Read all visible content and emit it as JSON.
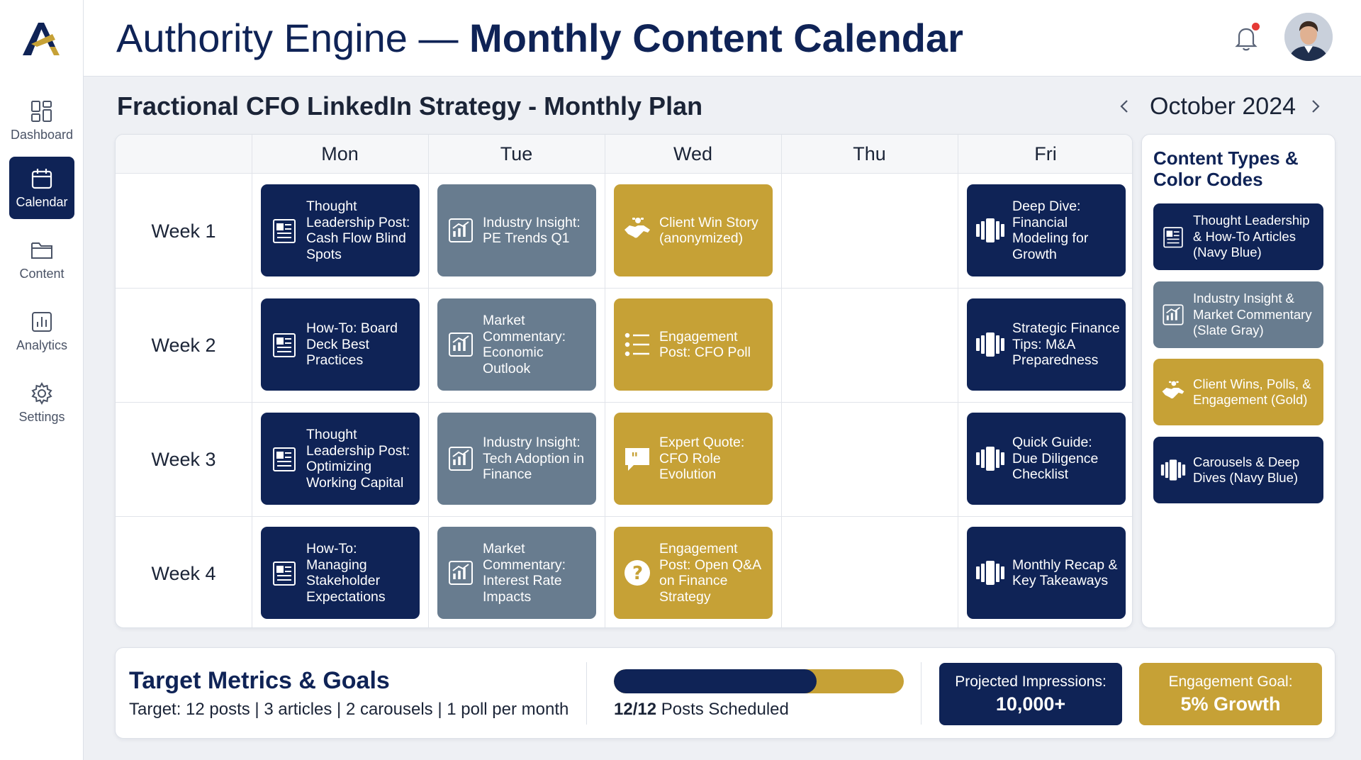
{
  "app": {
    "title_light": "Authority Engine — ",
    "title_bold": "Monthly Content Calendar"
  },
  "colors": {
    "navy": "#0f2356",
    "slate": "#687c8f",
    "gold": "#c6a136",
    "notification_dot": "#e53935"
  },
  "sidebar": {
    "items": [
      {
        "label": "Dashboard",
        "icon": "dashboard-icon",
        "active": false
      },
      {
        "label": "Calendar",
        "icon": "calendar-icon",
        "active": true
      },
      {
        "label": "Content",
        "icon": "folder-icon",
        "active": false
      },
      {
        "label": "Analytics",
        "icon": "bar-chart-icon",
        "active": false
      },
      {
        "label": "Settings",
        "icon": "gear-icon",
        "active": false
      }
    ]
  },
  "header": {
    "bell_icon": "bell-icon",
    "has_notification": true,
    "avatar": "user-avatar"
  },
  "plan": {
    "title": "Fractional CFO LinkedIn Strategy - Monthly Plan",
    "month": "October 2024"
  },
  "calendar": {
    "days": [
      "Mon",
      "Tue",
      "Wed",
      "Thu",
      "Fri"
    ],
    "weeks": [
      {
        "label": "Week 1",
        "cards": {
          "mon": {
            "text": "Thought Leadership Post: Cash Flow Blind Spots",
            "type": "navy",
            "icon": "article-icon"
          },
          "tue": {
            "text": "Industry Insight: PE Trends Q1",
            "type": "slate",
            "icon": "chart-icon"
          },
          "wed": {
            "text": "Client Win Story (anonymized)",
            "type": "gold",
            "icon": "handshake-icon"
          },
          "fri": {
            "text": "Deep Dive: Financial Modeling for Growth",
            "type": "navy",
            "icon": "carousel-icon"
          }
        }
      },
      {
        "label": "Week 2",
        "cards": {
          "mon": {
            "text": "How-To: Board Deck Best Practices",
            "type": "navy",
            "icon": "article-icon"
          },
          "tue": {
            "text": "Market Commentary: Economic Outlook",
            "type": "slate",
            "icon": "chart-icon"
          },
          "wed": {
            "text": "Engagement Post: CFO Poll",
            "type": "gold",
            "icon": "poll-list-icon"
          },
          "fri": {
            "text": "Strategic Finance Tips: M&A Preparedness",
            "type": "navy",
            "icon": "carousel-icon"
          }
        }
      },
      {
        "label": "Week 3",
        "cards": {
          "mon": {
            "text": "Thought Leadership Post: Optimizing Working Capital",
            "type": "navy",
            "icon": "article-icon"
          },
          "tue": {
            "text": "Industry Insight: Tech Adoption in Finance",
            "type": "slate",
            "icon": "chart-icon"
          },
          "wed": {
            "text": "Expert Quote: CFO Role Evolution",
            "type": "gold",
            "icon": "quote-icon"
          },
          "fri": {
            "text": "Quick Guide: Due Diligence Checklist",
            "type": "navy",
            "icon": "carousel-icon"
          }
        }
      },
      {
        "label": "Week 4",
        "cards": {
          "mon": {
            "text": "How-To: Managing Stakeholder Expectations",
            "type": "navy",
            "icon": "article-icon"
          },
          "tue": {
            "text": "Market Commentary: Interest Rate Impacts",
            "type": "slate",
            "icon": "chart-icon"
          },
          "wed": {
            "text": "Engagement Post: Open Q&A on Finance Strategy",
            "type": "gold",
            "icon": "question-icon"
          },
          "fri": {
            "text": "Monthly Recap & Key Takeaways",
            "type": "navy",
            "icon": "carousel-icon"
          }
        }
      }
    ]
  },
  "legend": {
    "title": "Content Types & Color Codes",
    "items": [
      {
        "text": "Thought Leadership & How-To Articles (Navy Blue)",
        "type": "navy",
        "icon": "article-icon"
      },
      {
        "text": "Industry Insight & Market Commentary (Slate Gray)",
        "type": "slate",
        "icon": "chart-icon"
      },
      {
        "text": "Client Wins, Polls, & Engagement (Gold)",
        "type": "gold",
        "icon": "handshake-icon"
      },
      {
        "text": "Carousels & Deep Dives (Navy Blue)",
        "type": "navy",
        "icon": "carousel-icon"
      }
    ]
  },
  "metrics": {
    "title": "Target Metrics & Goals",
    "target": "Target: 12 posts | 3 articles | 2 carousels | 1 poll per month",
    "progress_fraction": 0.7,
    "progress_count": "12/12",
    "progress_label": " Posts Scheduled",
    "impressions_label": "Projected Impressions:",
    "impressions_value": "10,000+",
    "engagement_label": "Engagement Goal:",
    "engagement_value": "5% Growth"
  }
}
